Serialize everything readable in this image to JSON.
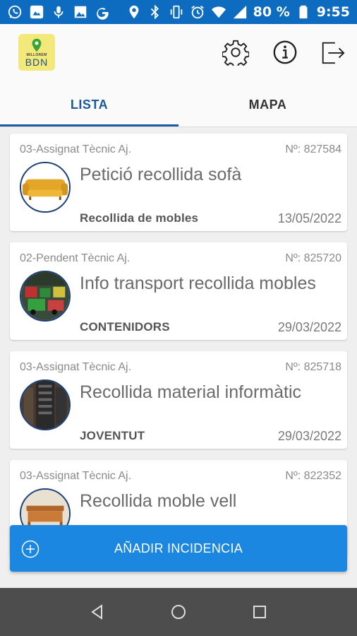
{
  "status_bar": {
    "battery": "80 %",
    "time": "9:55",
    "left_icons": [
      "whatsapp-icon",
      "photo-app-icon",
      "microphone-icon",
      "gallery-icon",
      "google-icon"
    ],
    "right_icons": [
      "location-icon",
      "bluetooth-icon",
      "vibrate-icon",
      "alarm-icon",
      "wifi-icon",
      "signal-icon",
      "battery-icon"
    ]
  },
  "app_bar": {
    "logo_small": "MILLOREM",
    "logo_big": "BDN",
    "actions": [
      "settings-icon",
      "info-icon",
      "logout-icon"
    ]
  },
  "tabs": [
    {
      "label": "LISTA",
      "active": true
    },
    {
      "label": "MAPA",
      "active": false
    }
  ],
  "incidents": [
    {
      "status": "03-Assignat Tècnic Aj.",
      "number": "Nº: 827584",
      "title": "Petició recollida sofà",
      "category": "Recollida de mobles",
      "date": "13/05/2022",
      "image": "sofa"
    },
    {
      "status": "02-Pendent Tècnic Aj.",
      "number": "Nº: 825720",
      "title": "Info transport recollida mobles",
      "category": "CONTENIDORS",
      "date": "29/03/2022",
      "image": "containers"
    },
    {
      "status": "03-Assignat Tècnic Aj.",
      "number": "Nº: 825718",
      "title": "Recollida material informàtic",
      "category": "JOVENTUT",
      "date": "29/03/2022",
      "image": "computer"
    },
    {
      "status": "03-Assignat Tècnic Aj.",
      "number": "Nº: 822352",
      "title": "Recollida moble vell",
      "category": "",
      "date": "",
      "image": "furniture"
    }
  ],
  "add_button": {
    "label": "AÑADIR INCIDENCIA"
  },
  "colors": {
    "primary": "#0d6cc0",
    "accent": "#1b87e0",
    "tab_active": "#1b5aa0"
  }
}
